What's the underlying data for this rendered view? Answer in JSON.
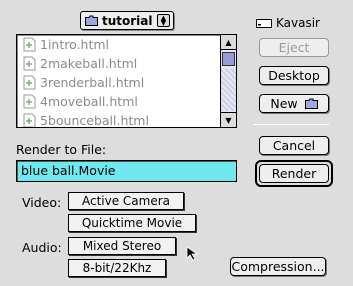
{
  "folder_popup": {
    "label": "tutorial"
  },
  "file_list": {
    "items": [
      "1intro.html",
      "2makeball.html",
      "3renderball.html",
      "4moveball.html",
      "5bounceball.html"
    ]
  },
  "volume": {
    "name": "Kavasir"
  },
  "buttons": {
    "eject": "Eject",
    "desktop": "Desktop",
    "new": "New",
    "cancel": "Cancel",
    "render": "Render",
    "compression": "Compression..."
  },
  "render_to_file": {
    "label": "Render to File:",
    "value": "blue ball.Movie"
  },
  "video": {
    "label": "Video:",
    "options": [
      "Active Camera",
      "Quicktime Movie"
    ]
  },
  "audio": {
    "label": "Audio:",
    "options": [
      "Mixed Stereo",
      "8-bit/22Khz"
    ]
  },
  "colors": {
    "background": "#dddddd",
    "field_highlight": "#6fe8ef"
  }
}
